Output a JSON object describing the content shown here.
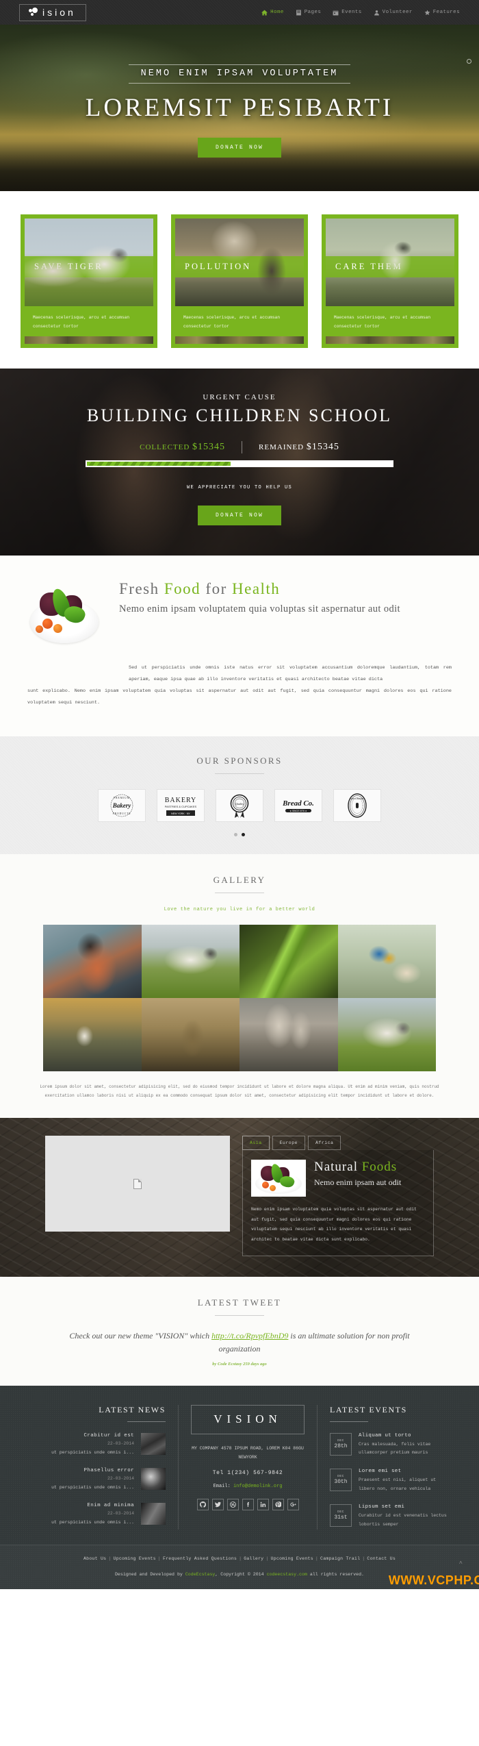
{
  "header": {
    "logo_text": "ision",
    "nav": [
      {
        "label": "Home",
        "icon": "home-icon",
        "active": true
      },
      {
        "label": "Pages",
        "icon": "pages-icon",
        "active": false
      },
      {
        "label": "Events",
        "icon": "events-icon",
        "active": false
      },
      {
        "label": "Volunteer",
        "icon": "volunteer-icon",
        "active": false
      },
      {
        "label": "Features",
        "icon": "features-icon",
        "active": false
      }
    ]
  },
  "hero": {
    "subtitle": "NEMO ENIM IPSAM VOLUPTATEM",
    "title": "LOREMSIT PESIBARTI",
    "cta": "DONATE NOW"
  },
  "cards": [
    {
      "label": "SAVE TIGER",
      "text": "Maecenas scelerisque, arcu et accumsan consectetur tortor"
    },
    {
      "label": "POLLUTION",
      "text": "Maecenas scelerisque, arcu et accumsan consectetur tortor"
    },
    {
      "label": "CARE THEM",
      "text": "Maecenas scelerisque, arcu et accumsan consectetur tortor"
    }
  ],
  "urgent": {
    "kicker": "URGENT CAUSE",
    "title": "BUILDING CHILDREN SCHOOL",
    "collected_label": "COLLECTED",
    "collected_value": "$15345",
    "remained_label": "REMAINED",
    "remained_value": "$15345",
    "progress_percent": 47,
    "appreciate": "WE APPRECIATE YOU TO HELP US",
    "cta": "DONATE NOW"
  },
  "fresh": {
    "head_1": "Fresh ",
    "head_2": "Food",
    "head_3": " for ",
    "head_4": "Health",
    "sub": "Nemo enim ipsam voluptatem quia voluptas sit aspernatur aut odit",
    "para_line1": "Sed ut perspiciatis unde omnis iste natus error sit voluptatem accusantium doloremque laudantium, totam rem aperiam, eaque ipsa quae ab illo inventore veritatis et quasi architecto beatae vitae dicta",
    "para_line2": "sunt explicabo. Nemo enim ipsam voluptatem quia voluptas sit aspernatur aut odit aut fugit, sed quia consequuntur magni dolores eos qui ratione voluptatem sequi nesciunt."
  },
  "sponsors": {
    "title": "OUR SPONSORS",
    "items": [
      {
        "name": "premium-bakery-products-logo",
        "line1": "PREMIUM",
        "line2": "Bakery",
        "line3": "PRODUCTS"
      },
      {
        "name": "bakery-pastries-cupcakes-logo",
        "line1": "BAKERY",
        "line2": "PASTRIES & CUPCAKES",
        "line3": "NEW YORK · NY"
      },
      {
        "name": "quality-seal-logo",
        "line1": "Quality",
        "line2": "",
        "line3": ""
      },
      {
        "name": "bread-co-logo",
        "line1": "Bread Co.",
        "line2": "SINCE 1976",
        "line3": ""
      },
      {
        "name": "cafe-bakery-oval-logo",
        "line1": "CAFE & BAKERY",
        "line2": "",
        "line3": ""
      }
    ],
    "dots": [
      false,
      true
    ]
  },
  "gallery": {
    "title": "GALLERY",
    "note": "Love the nature you live in for a better world",
    "items": [
      "gallery-child-photo",
      "gallery-white-tiger-photo",
      "gallery-green-snake-photo",
      "gallery-bird-on-hand-photo",
      "gallery-bird-sunset-photo",
      "gallery-rabbit-photo",
      "gallery-factory-pollution-photo",
      "gallery-white-tiger-grass-photo"
    ],
    "footer_line1": "Lorem ipsum dolor sit amet, consectetur adipisicing elit, sed do eiusmod tempor incididunt ut labore et dolore magna aliqua. Ut enim ad minim veniam, quis nostrud exercitation",
    "footer_line2": "ullamco laboris nisi ut aliquip ex ea commodo consequat ipsum dolor sit amet, consectetur adipisicing elit tempor incididunt ut labore et dolore."
  },
  "natural": {
    "tabs": [
      {
        "label": "Asia",
        "active": true
      },
      {
        "label": "Europe",
        "active": false
      },
      {
        "label": "Africa",
        "active": false
      }
    ],
    "head_1": "Natural ",
    "head_2": "Foods",
    "sub": "Nemo enim ipsam aut odit",
    "para": "Nemo enim ipsam voluptatem quia voluptas sit aspernatur aut odit aut fugit, sed quia consequuntur magni dolores eos qui ratione voluptatem sequi nesciunt ab illo inventore veritatis et quasi architec to beatae vitae dicta sunt explicabo."
  },
  "tweet": {
    "title": "LATEST TWEET",
    "text_before": "Check out our new theme \"VISION\" which ",
    "link": "http://t.co/RpvpfEbnD9",
    "text_after": " is an ultimate solution for non profit organization",
    "meta": "by Code Ecstasy 259 days ago"
  },
  "footer": {
    "news_title": "LATEST NEWS",
    "news": [
      {
        "headline": "Crabitur id est",
        "date": "22-03-2014",
        "excerpt": "ut perspiciatis unde omnis i...",
        "thumb": "news-thumb-1"
      },
      {
        "headline": "Phasellus error",
        "date": "22-03-2014",
        "excerpt": "ut perspiciatis unde omnis i...",
        "thumb": "news-thumb-2"
      },
      {
        "headline": "Enim ad minima",
        "date": "22-03-2014",
        "excerpt": "ut perspiciatis unde omnis i...",
        "thumb": "news-thumb-3"
      }
    ],
    "brand": "VISION",
    "address": "MY COMPANY 4578 IPSUM ROAD, LOREM K04 86GU NEWYORK",
    "tel": "Tel 1(234) 567-9842",
    "email_label": "Email: ",
    "email": "info@demolink.org",
    "socials": [
      "github-icon",
      "twitter-icon",
      "dribbble-icon",
      "facebook-icon",
      "linkedin-icon",
      "pinterest-icon",
      "google-plus-icon"
    ],
    "events_title": "LATEST EVENTS",
    "events": [
      {
        "month": "DEC",
        "day": "28th",
        "headline": "Aliquam ut torto",
        "text": "Cras malesuada, felis vitae ullamcorper pretium mauris"
      },
      {
        "month": "DEC",
        "day": "30th",
        "headline": "Lorem emi set",
        "text": "Praesent est nisi, aliquet ut libero non, ornare vehicula"
      },
      {
        "month": "DEC",
        "day": "31st",
        "headline": "Lipsum set emi",
        "text": "Curabitur id est venenatis lectus lobortis semper"
      }
    ]
  },
  "bottom": {
    "links": [
      "About Us",
      "Upcoming Events",
      "Frequently Asked Questions",
      "Gallery",
      "Upcoming Events",
      "Campaign Trail",
      "Contact Us"
    ],
    "copy_1": "Designed and Developed by ",
    "copy_brand": "CodeEcstasy",
    "copy_2": ", Copyright © 2014 ",
    "copy_site": "codeecstasy.com",
    "copy_3": " all rights reserved.",
    "watermark": "WWW.VCPHP.C"
  },
  "colors": {
    "accent": "#7ab51f",
    "accent_dark": "#68a51a",
    "dark": "#2b2b2b",
    "footer": "#33393a"
  }
}
